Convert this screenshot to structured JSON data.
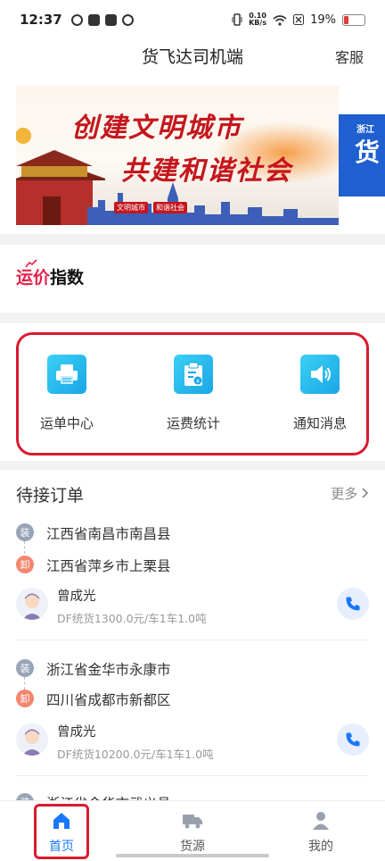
{
  "status_bar": {
    "time": "12:37",
    "net_speed_value": "0.10",
    "net_speed_unit": "KB/s",
    "battery": "19%",
    "battery_level": 0.19
  },
  "header": {
    "title": "货飞达司机端",
    "service": "客服"
  },
  "banner": {
    "line1": "创建文明城市",
    "line2": "共建和谐社会",
    "tags": [
      "文明城市",
      "和谐社会"
    ],
    "side_top": "浙江",
    "side_big": "货"
  },
  "price_index": {
    "accent": "运价",
    "label": "指数"
  },
  "quick_entries": [
    {
      "label": "运单中心",
      "icon": "printer-icon"
    },
    {
      "label": "运费统计",
      "icon": "clipboard-money-icon"
    },
    {
      "label": "通知消息",
      "icon": "speaker-icon"
    }
  ],
  "orders": {
    "title": "待接订单",
    "more": "更多",
    "items": [
      {
        "load_tag": "装",
        "unload_tag": "卸",
        "from": "江西省南昌市南昌县",
        "to": "江西省萍乡市上栗县",
        "name": "曾成光",
        "desc": "DF统货1300.0元/车1车1.0吨"
      },
      {
        "load_tag": "装",
        "unload_tag": "卸",
        "from": "浙江省金华市永康市",
        "to": "四川省成都市新都区",
        "name": "曾成光",
        "desc": "DF统货10200.0元/车1车1.0吨"
      },
      {
        "load_tag": "装",
        "from": "浙江省金华市武义县"
      }
    ]
  },
  "tabbar": {
    "tabs": [
      {
        "label": "首页",
        "icon": "home-icon",
        "active": true
      },
      {
        "label": "货源",
        "icon": "truck-icon",
        "active": false
      },
      {
        "label": "我的",
        "icon": "user-icon",
        "active": false
      }
    ]
  },
  "colors": {
    "accent_blue": "#1976ff",
    "highlight_red": "#d81b30",
    "icon_gradient_start": "#3ad0f4",
    "icon_gradient_end": "#1aa6e6",
    "load_tag": "#9aa4b8",
    "unload_tag": "#f3866e"
  }
}
